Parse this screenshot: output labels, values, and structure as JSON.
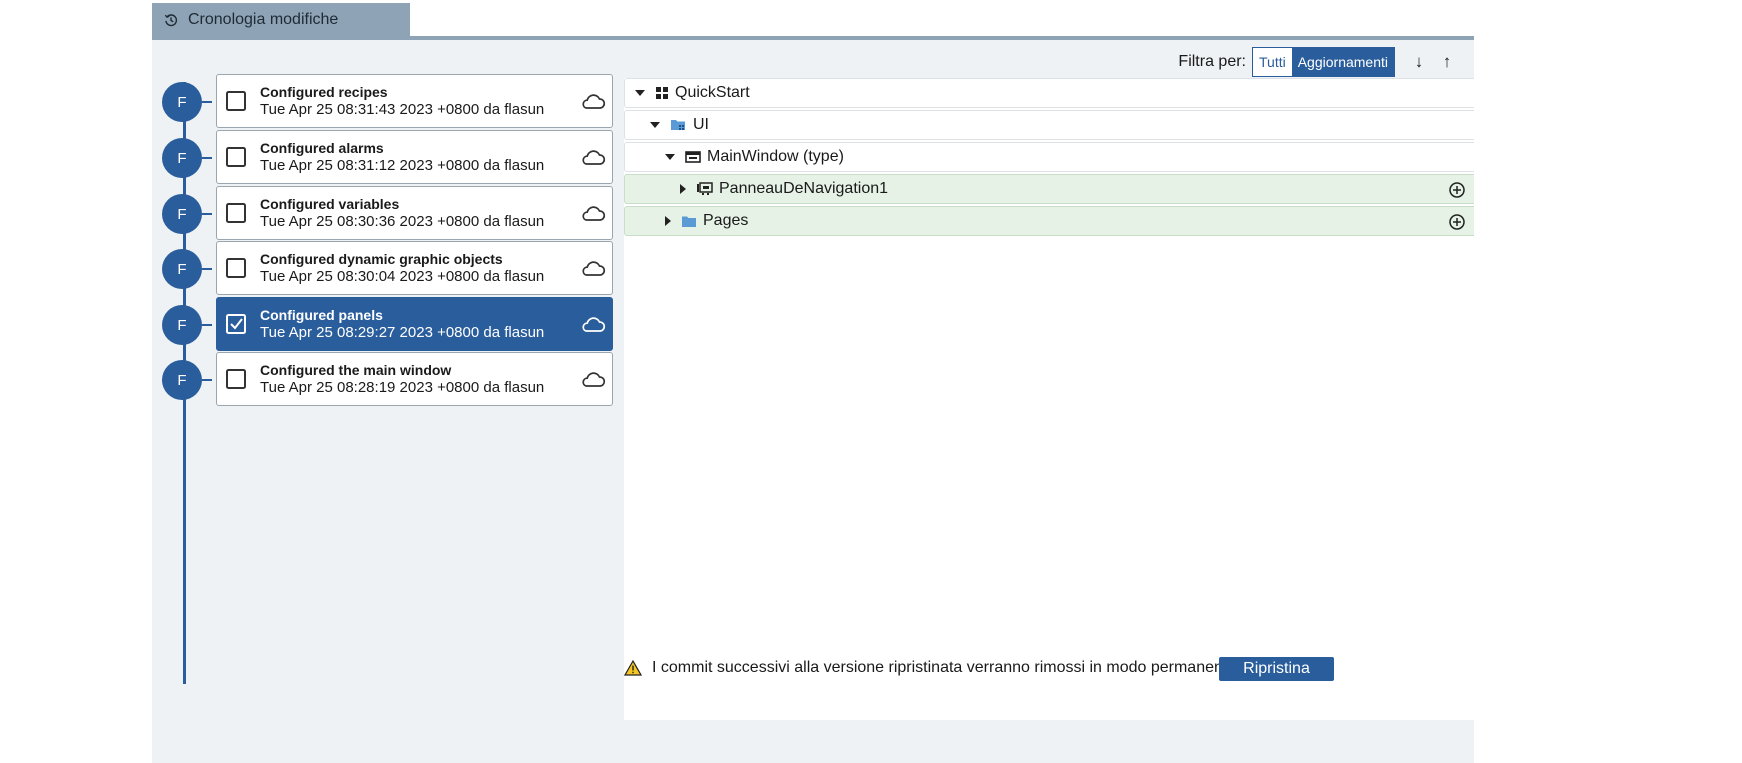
{
  "tab": {
    "title": "Cronologia modifiche",
    "icon": "history-icon"
  },
  "filter": {
    "label": "Filtra per:",
    "options": [
      "Tutti",
      "Aggiornamenti"
    ],
    "selected": "Aggiornamenti",
    "sort_desc": "↓",
    "sort_asc": "↑"
  },
  "commits": [
    {
      "avatar": "F",
      "title": "Configured recipes",
      "meta": "Tue Apr 25 08:31:43 2023 +0800 da flasun",
      "checked": false
    },
    {
      "avatar": "F",
      "title": "Configured alarms",
      "meta": "Tue Apr 25 08:31:12 2023 +0800 da flasun",
      "checked": false
    },
    {
      "avatar": "F",
      "title": "Configured variables",
      "meta": "Tue Apr 25 08:30:36 2023 +0800 da flasun",
      "checked": false
    },
    {
      "avatar": "F",
      "title": "Configured dynamic graphic objects",
      "meta": "Tue Apr 25 08:30:04 2023 +0800 da flasun",
      "checked": false
    },
    {
      "avatar": "F",
      "title": "Configured panels",
      "meta": "Tue Apr 25 08:29:27 2023 +0800 da flasun",
      "checked": true
    },
    {
      "avatar": "F",
      "title": "Configured the main window",
      "meta": "Tue Apr 25 08:28:19 2023 +0800 da flasun",
      "checked": false
    }
  ],
  "tree": [
    {
      "label": "QuickStart",
      "icon": "grid-icon",
      "expanded": true,
      "status": "unchanged"
    },
    {
      "label": "UI",
      "icon": "ui-folder-icon",
      "expanded": true,
      "status": "unchanged"
    },
    {
      "label": "MainWindow (type)",
      "icon": "window-icon",
      "expanded": true,
      "status": "unchanged"
    },
    {
      "label": "PanneauDeNavigation1",
      "icon": "navigation-panel-icon",
      "expanded": false,
      "status": "added"
    },
    {
      "label": "Pages",
      "icon": "folder-icon",
      "expanded": false,
      "status": "added"
    }
  ],
  "footer": {
    "warning": "I commit successivi alla versione ripristinata verranno rimossi in modo permanente.",
    "restore_label": "Ripristina"
  },
  "colors": {
    "primary": "#2a5d9c",
    "added_row": "#e6f2e6",
    "tab_bg": "#8ea3b5",
    "panel_bg": "#eef2f5"
  }
}
